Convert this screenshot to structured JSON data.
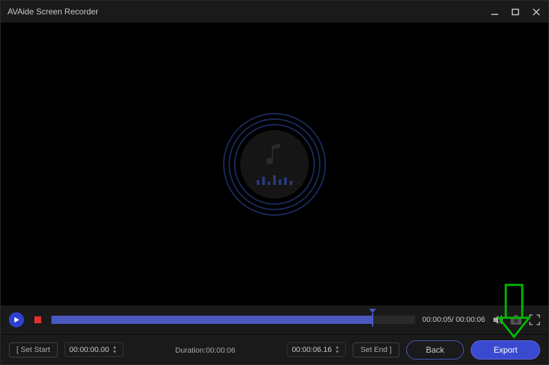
{
  "title": "AVAide Screen Recorder",
  "playback": {
    "current_time": "00:00:05",
    "total_time": "00:00:06"
  },
  "clip": {
    "set_start_label": "[ Set Start",
    "start_time": "00:00:00.00",
    "duration_label": "Duration:",
    "duration_value": "00:00:06",
    "end_time": "00:00:06.16",
    "set_end_label": "Set End ]"
  },
  "buttons": {
    "back": "Back",
    "export": "Export"
  }
}
